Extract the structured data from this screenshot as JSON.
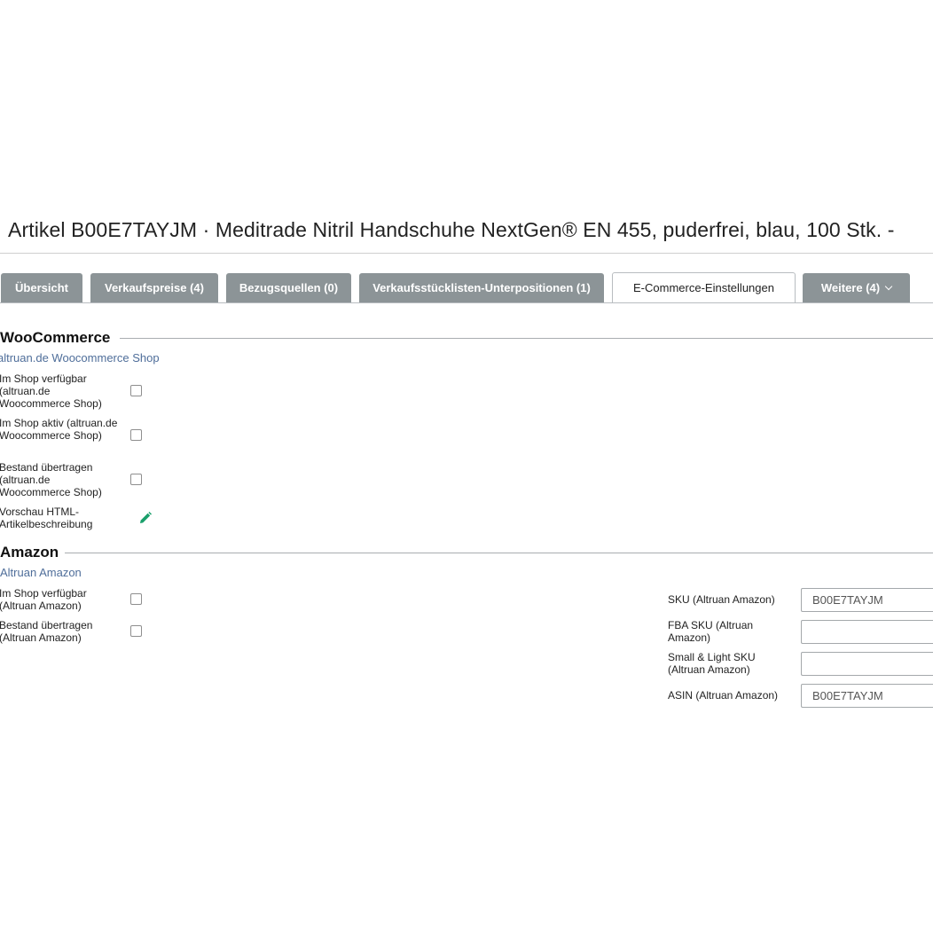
{
  "header": {
    "title": "Artikel B00E7TAYJM · Meditrade Nitril Handschuhe NextGen® EN 455, puderfrei, blau, 100 Stk. -"
  },
  "tabs": [
    {
      "label": "Übersicht",
      "active": false
    },
    {
      "label": "Verkaufspreise (4)",
      "active": false
    },
    {
      "label": "Bezugsquellen (0)",
      "active": false
    },
    {
      "label": "Verkaufsstücklisten-Unterpositionen (1)",
      "active": false
    },
    {
      "label": "E-Commerce-Einstellungen",
      "active": true
    },
    {
      "label": "Weitere (4)",
      "active": false,
      "icon": "chevron-down-icon"
    }
  ],
  "woocommerce": {
    "section_title": "WooCommerce",
    "shop_name": "altruan.de Woocommerce Shop",
    "fields": [
      {
        "label": "Im Shop verfügbar (altruan.de Woocommerce Shop)",
        "checked": false
      },
      {
        "label": "Im Shop aktiv (altruan.de Woocommerce Shop)",
        "checked": false
      },
      {
        "label": "Bestand übertragen (altruan.de Woocommerce Shop)",
        "checked": false
      }
    ],
    "preview_label": "Vorschau HTML-Artikelbeschreibung",
    "preview_icon": "pencil-icon",
    "preview_icon_color": "#1a9f6b"
  },
  "amazon": {
    "section_title": "Amazon",
    "shop_name": "Altruan Amazon",
    "fields": [
      {
        "label": "Im Shop verfügbar (Altruan Amazon)",
        "checked": false
      },
      {
        "label": "Bestand übertragen (Altruan Amazon)",
        "checked": false
      }
    ],
    "inputs": [
      {
        "label": "SKU (Altruan Amazon)",
        "value": "B00E7TAYJM"
      },
      {
        "label": "FBA SKU (Altruan Amazon)",
        "value": ""
      },
      {
        "label": "Small & Light SKU (Altruan Amazon)",
        "value": ""
      },
      {
        "label": "ASIN (Altruan Amazon)",
        "value": "B00E7TAYJM"
      }
    ]
  },
  "colors": {
    "tab_inactive_bg": "#8c9497",
    "link": "#4f6e9a"
  }
}
